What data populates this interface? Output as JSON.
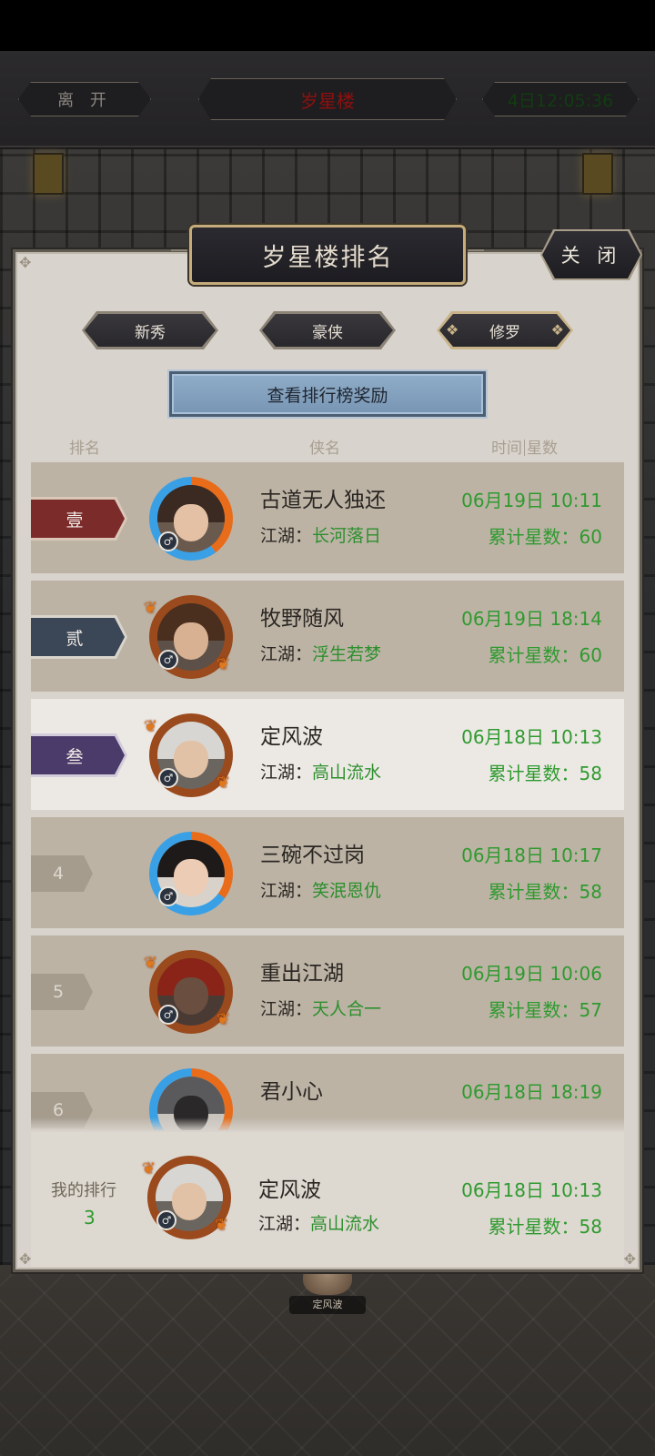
{
  "header": {
    "leave_label": "离 开",
    "location_title": "岁星楼",
    "timer": "4日12:05:36"
  },
  "panel": {
    "title": "岁星楼排名",
    "close_label": "关 闭",
    "tabs": [
      {
        "label": "新秀",
        "active": false
      },
      {
        "label": "豪侠",
        "active": false
      },
      {
        "label": "修罗",
        "active": true
      }
    ],
    "reward_button": "查看排行榜奖励",
    "columns": {
      "rank": "排名",
      "name": "侠名",
      "time": "时间",
      "stars": "星数"
    },
    "guild_prefix": "江湖：",
    "stars_prefix": "累计星数：",
    "gender_symbol": "♂"
  },
  "ranking": [
    {
      "rank": "壹",
      "name": "古道无人独还",
      "guild": "长河落日",
      "time": "06月19日 10:11",
      "stars": "60",
      "badge_color": "#7c2b2b"
    },
    {
      "rank": "贰",
      "name": "牧野随风",
      "guild": "浮生若梦",
      "time": "06月19日 18:14",
      "stars": "60",
      "badge_color": "#3b4656"
    },
    {
      "rank": "叁",
      "name": "定风波",
      "guild": "高山流水",
      "time": "06月18日 10:13",
      "stars": "58",
      "badge_color": "#4b3b6a",
      "is_self": true
    },
    {
      "rank": "4",
      "name": "三碗不过岗",
      "guild": "笑泯恩仇",
      "time": "06月18日 10:17",
      "stars": "58"
    },
    {
      "rank": "5",
      "name": "重出江湖",
      "guild": "天人合一",
      "time": "06月19日 10:06",
      "stars": "57"
    },
    {
      "rank": "6",
      "name": "君小心",
      "guild": "",
      "time": "06月18日 18:19",
      "stars": ""
    }
  ],
  "my_rank": {
    "label": "我的排行",
    "position": "3",
    "name": "定风波",
    "guild": "高山流水",
    "time": "06月18日 10:13",
    "stars": "58"
  },
  "background": {
    "player_tag": "定风波"
  }
}
